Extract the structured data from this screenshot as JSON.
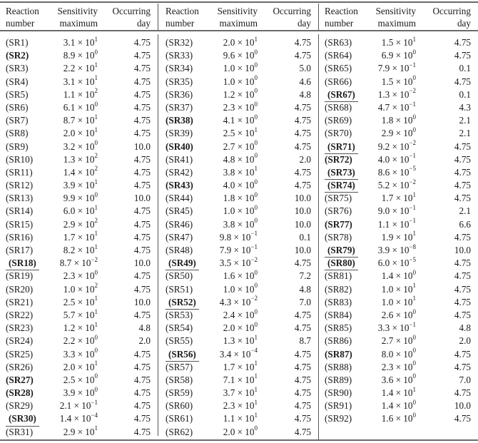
{
  "headers": {
    "reaction_line1": "Reaction",
    "reaction_line2": "number",
    "sensitivity_line1": "Sensitivity",
    "sensitivity_line2": "maximum",
    "day_line1": "Occurring",
    "day_line2": "day"
  },
  "groups": [
    {
      "rows": [
        {
          "reaction": "(SR1)",
          "mantissa": "3.1",
          "exponent": "1",
          "day": "4.75",
          "style": "normal"
        },
        {
          "reaction": "(SR2)",
          "mantissa": "8.9",
          "exponent": "0",
          "day": "4.75",
          "style": "bold"
        },
        {
          "reaction": "(SR3)",
          "mantissa": "2.2",
          "exponent": "1",
          "day": "4.75",
          "style": "normal"
        },
        {
          "reaction": "(SR4)",
          "mantissa": "3.1",
          "exponent": "1",
          "day": "4.75",
          "style": "normal"
        },
        {
          "reaction": "(SR5)",
          "mantissa": "1.1",
          "exponent": "2",
          "day": "4.75",
          "style": "normal"
        },
        {
          "reaction": "(SR6)",
          "mantissa": "6.1",
          "exponent": "0",
          "day": "4.75",
          "style": "normal"
        },
        {
          "reaction": "(SR7)",
          "mantissa": "8.7",
          "exponent": "1",
          "day": "4.75",
          "style": "normal"
        },
        {
          "reaction": "(SR8)",
          "mantissa": "2.0",
          "exponent": "1",
          "day": "4.75",
          "style": "normal"
        },
        {
          "reaction": "(SR9)",
          "mantissa": "3.2",
          "exponent": "0",
          "day": "10.0",
          "style": "normal"
        },
        {
          "reaction": "(SR10)",
          "mantissa": "1.3",
          "exponent": "2",
          "day": "4.75",
          "style": "normal"
        },
        {
          "reaction": "(SR11)",
          "mantissa": "1.4",
          "exponent": "2",
          "day": "4.75",
          "style": "normal"
        },
        {
          "reaction": "(SR12)",
          "mantissa": "3.9",
          "exponent": "1",
          "day": "4.75",
          "style": "normal"
        },
        {
          "reaction": "(SR13)",
          "mantissa": "9.9",
          "exponent": "0",
          "day": "10.0",
          "style": "normal"
        },
        {
          "reaction": "(SR14)",
          "mantissa": "6.0",
          "exponent": "1",
          "day": "4.75",
          "style": "normal"
        },
        {
          "reaction": "(SR15)",
          "mantissa": "2.9",
          "exponent": "2",
          "day": "4.75",
          "style": "normal"
        },
        {
          "reaction": "(SR16)",
          "mantissa": "1.7",
          "exponent": "1",
          "day": "4.75",
          "style": "normal"
        },
        {
          "reaction": "(SR17)",
          "mantissa": "8.2",
          "exponent": "1",
          "day": "4.75",
          "style": "normal"
        },
        {
          "reaction": "(SR18)",
          "mantissa": "8.7",
          "exponent": "−2",
          "day": "10.0",
          "style": "underline"
        },
        {
          "reaction": "(SR19)",
          "mantissa": "2.3",
          "exponent": "0",
          "day": "4.75",
          "style": "normal"
        },
        {
          "reaction": "(SR20)",
          "mantissa": "1.0",
          "exponent": "2",
          "day": "4.75",
          "style": "normal"
        },
        {
          "reaction": "(SR21)",
          "mantissa": "2.5",
          "exponent": "1",
          "day": "10.0",
          "style": "normal"
        },
        {
          "reaction": "(SR22)",
          "mantissa": "5.7",
          "exponent": "1",
          "day": "4.75",
          "style": "normal"
        },
        {
          "reaction": "(SR23)",
          "mantissa": "1.2",
          "exponent": "1",
          "day": "4.8",
          "style": "normal"
        },
        {
          "reaction": "(SR24)",
          "mantissa": "2.2",
          "exponent": "0",
          "day": "2.0",
          "style": "normal"
        },
        {
          "reaction": "(SR25)",
          "mantissa": "3.3",
          "exponent": "0",
          "day": "4.75",
          "style": "normal"
        },
        {
          "reaction": "(SR26)",
          "mantissa": "2.0",
          "exponent": "1",
          "day": "4.75",
          "style": "normal"
        },
        {
          "reaction": "(SR27)",
          "mantissa": "2.5",
          "exponent": "0",
          "day": "4.75",
          "style": "bold"
        },
        {
          "reaction": "(SR28)",
          "mantissa": "3.9",
          "exponent": "0",
          "day": "4.75",
          "style": "bold"
        },
        {
          "reaction": "(SR29)",
          "mantissa": "2.1",
          "exponent": "−1",
          "day": "4.75",
          "style": "normal"
        },
        {
          "reaction": "(SR30)",
          "mantissa": "1.4",
          "exponent": "−4",
          "day": "4.75",
          "style": "underline"
        },
        {
          "reaction": "(SR31)",
          "mantissa": "2.9",
          "exponent": "1",
          "day": "4.75",
          "style": "normal"
        }
      ]
    },
    {
      "rows": [
        {
          "reaction": "(SR32)",
          "mantissa": "2.0",
          "exponent": "1",
          "day": "4.75",
          "style": "normal"
        },
        {
          "reaction": "(SR33)",
          "mantissa": "9.6",
          "exponent": "0",
          "day": "4.75",
          "style": "normal"
        },
        {
          "reaction": "(SR34)",
          "mantissa": "1.0",
          "exponent": "0",
          "day": "5.0",
          "style": "normal"
        },
        {
          "reaction": "(SR35)",
          "mantissa": "1.0",
          "exponent": "0",
          "day": "4.6",
          "style": "normal"
        },
        {
          "reaction": "(SR36)",
          "mantissa": "1.2",
          "exponent": "0",
          "day": "4.8",
          "style": "normal"
        },
        {
          "reaction": "(SR37)",
          "mantissa": "2.3",
          "exponent": "0",
          "day": "4.75",
          "style": "normal"
        },
        {
          "reaction": "(SR38)",
          "mantissa": "4.1",
          "exponent": "0",
          "day": "4.75",
          "style": "bold"
        },
        {
          "reaction": "(SR39)",
          "mantissa": "2.5",
          "exponent": "1",
          "day": "4.75",
          "style": "normal"
        },
        {
          "reaction": "(SR40)",
          "mantissa": "2.7",
          "exponent": "0",
          "day": "4.75",
          "style": "bold"
        },
        {
          "reaction": "(SR41)",
          "mantissa": "4.8",
          "exponent": "0",
          "day": "2.0",
          "style": "normal"
        },
        {
          "reaction": "(SR42)",
          "mantissa": "3.8",
          "exponent": "1",
          "day": "4.75",
          "style": "normal"
        },
        {
          "reaction": "(SR43)",
          "mantissa": "4.0",
          "exponent": "0",
          "day": "4.75",
          "style": "bold"
        },
        {
          "reaction": "(SR44)",
          "mantissa": "1.8",
          "exponent": "0",
          "day": "10.0",
          "style": "normal"
        },
        {
          "reaction": "(SR45)",
          "mantissa": "1.0",
          "exponent": "0",
          "day": "10.0",
          "style": "normal"
        },
        {
          "reaction": "(SR46)",
          "mantissa": "3.8",
          "exponent": "0",
          "day": "10.0",
          "style": "normal"
        },
        {
          "reaction": "(SR47)",
          "mantissa": "9.8",
          "exponent": "−1",
          "day": "0.1",
          "style": "normal"
        },
        {
          "reaction": "(SR48)",
          "mantissa": "7.9",
          "exponent": "−1",
          "day": "10.0",
          "style": "normal"
        },
        {
          "reaction": "(SR49)",
          "mantissa": "3.5",
          "exponent": "−2",
          "day": "4.75",
          "style": "underline"
        },
        {
          "reaction": "(SR50)",
          "mantissa": "1.6",
          "exponent": "0",
          "day": "7.2",
          "style": "normal"
        },
        {
          "reaction": "(SR51)",
          "mantissa": "1.0",
          "exponent": "0",
          "day": "4.8",
          "style": "normal"
        },
        {
          "reaction": "(SR52)",
          "mantissa": "4.3",
          "exponent": "−2",
          "day": "7.0",
          "style": "underline"
        },
        {
          "reaction": "(SR53)",
          "mantissa": "2.4",
          "exponent": "0",
          "day": "4.75",
          "style": "normal"
        },
        {
          "reaction": "(SR54)",
          "mantissa": "2.0",
          "exponent": "0",
          "day": "4.75",
          "style": "normal"
        },
        {
          "reaction": "(SR55)",
          "mantissa": "1.3",
          "exponent": "1",
          "day": "8.7",
          "style": "normal"
        },
        {
          "reaction": "(SR56)",
          "mantissa": "3.4",
          "exponent": "−4",
          "day": "4.75",
          "style": "underline"
        },
        {
          "reaction": "(SR57)",
          "mantissa": "1.7",
          "exponent": "1",
          "day": "4.75",
          "style": "normal"
        },
        {
          "reaction": "(SR58)",
          "mantissa": "7.1",
          "exponent": "1",
          "day": "4.75",
          "style": "normal"
        },
        {
          "reaction": "(SR59)",
          "mantissa": "3.7",
          "exponent": "1",
          "day": "4.75",
          "style": "normal"
        },
        {
          "reaction": "(SR60)",
          "mantissa": "2.3",
          "exponent": "1",
          "day": "4.75",
          "style": "normal"
        },
        {
          "reaction": "(SR61)",
          "mantissa": "1.1",
          "exponent": "1",
          "day": "4.75",
          "style": "normal"
        },
        {
          "reaction": "(SR62)",
          "mantissa": "2.0",
          "exponent": "0",
          "day": "4.75",
          "style": "normal"
        }
      ]
    },
    {
      "rows": [
        {
          "reaction": "(SR63)",
          "mantissa": "1.5",
          "exponent": "1",
          "day": "4.75",
          "style": "normal"
        },
        {
          "reaction": "(SR64)",
          "mantissa": "6.9",
          "exponent": "0",
          "day": "4.75",
          "style": "normal"
        },
        {
          "reaction": "(SR65)",
          "mantissa": "7.9",
          "exponent": "−1",
          "day": "0.1",
          "style": "normal"
        },
        {
          "reaction": "(SR66)",
          "mantissa": "1.5",
          "exponent": "0",
          "day": "4.75",
          "style": "normal"
        },
        {
          "reaction": "(SR67)",
          "mantissa": "1.3",
          "exponent": "−2",
          "day": "0.1",
          "style": "underline"
        },
        {
          "reaction": "(SR68)",
          "mantissa": "4.7",
          "exponent": "−1",
          "day": "4.3",
          "style": "normal"
        },
        {
          "reaction": "(SR69)",
          "mantissa": "1.8",
          "exponent": "0",
          "day": "2.1",
          "style": "normal"
        },
        {
          "reaction": "(SR70)",
          "mantissa": "2.9",
          "exponent": "0",
          "day": "2.1",
          "style": "normal"
        },
        {
          "reaction": "(SR71)",
          "mantissa": "9.2",
          "exponent": "−2",
          "day": "4.75",
          "style": "underline"
        },
        {
          "reaction": "(SR72)",
          "mantissa": "4.0",
          "exponent": "−1",
          "day": "4.75",
          "style": "bold"
        },
        {
          "reaction": "(SR73)",
          "mantissa": "8.6",
          "exponent": "−5",
          "day": "4.75",
          "style": "underline"
        },
        {
          "reaction": "(SR74)",
          "mantissa": "5.2",
          "exponent": "−2",
          "day": "4.75",
          "style": "underline"
        },
        {
          "reaction": "(SR75)",
          "mantissa": "1.7",
          "exponent": "1",
          "day": "4.75",
          "style": "normal"
        },
        {
          "reaction": "(SR76)",
          "mantissa": "9.0",
          "exponent": "−1",
          "day": "2.1",
          "style": "normal"
        },
        {
          "reaction": "(SR77)",
          "mantissa": "1.1",
          "exponent": "−1",
          "day": "6.6",
          "style": "bold"
        },
        {
          "reaction": "(SR78)",
          "mantissa": "1.9",
          "exponent": "1",
          "day": "4.75",
          "style": "normal"
        },
        {
          "reaction": "(SR79)",
          "mantissa": "3.9",
          "exponent": "−8",
          "day": "10.0",
          "style": "underline"
        },
        {
          "reaction": "(SR80)",
          "mantissa": "6.0",
          "exponent": "−5",
          "day": "4.75",
          "style": "underline"
        },
        {
          "reaction": "(SR81)",
          "mantissa": "1.4",
          "exponent": "0",
          "day": "4.75",
          "style": "normal"
        },
        {
          "reaction": "(SR82)",
          "mantissa": "1.0",
          "exponent": "1",
          "day": "4.75",
          "style": "normal"
        },
        {
          "reaction": "(SR83)",
          "mantissa": "1.0",
          "exponent": "1",
          "day": "4.75",
          "style": "normal"
        },
        {
          "reaction": "(SR84)",
          "mantissa": "2.6",
          "exponent": "0",
          "day": "4.75",
          "style": "normal"
        },
        {
          "reaction": "(SR85)",
          "mantissa": "3.3",
          "exponent": "−1",
          "day": "4.8",
          "style": "normal"
        },
        {
          "reaction": "(SR86)",
          "mantissa": "2.7",
          "exponent": "0",
          "day": "2.0",
          "style": "normal"
        },
        {
          "reaction": "(SR87)",
          "mantissa": "8.0",
          "exponent": "0",
          "day": "4.75",
          "style": "bold"
        },
        {
          "reaction": "(SR88)",
          "mantissa": "2.3",
          "exponent": "0",
          "day": "4.75",
          "style": "normal"
        },
        {
          "reaction": "(SR89)",
          "mantissa": "3.6",
          "exponent": "0",
          "day": "7.0",
          "style": "normal"
        },
        {
          "reaction": "(SR90)",
          "mantissa": "1.4",
          "exponent": "1",
          "day": "4.75",
          "style": "normal"
        },
        {
          "reaction": "(SR91)",
          "mantissa": "1.4",
          "exponent": "0",
          "day": "10.0",
          "style": "normal"
        },
        {
          "reaction": "(SR92)",
          "mantissa": "1.6",
          "exponent": "0",
          "day": "4.75",
          "style": "normal"
        }
      ]
    }
  ]
}
